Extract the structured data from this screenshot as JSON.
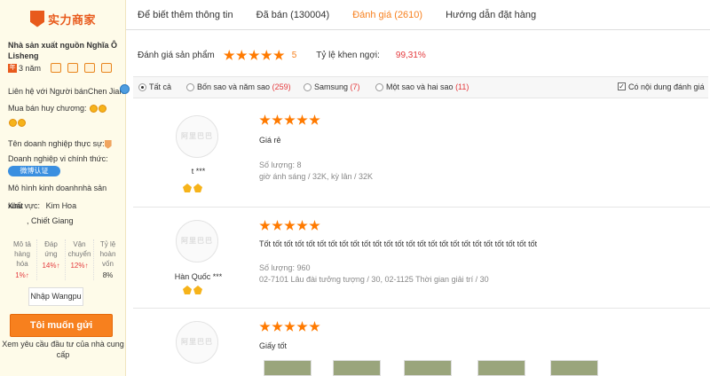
{
  "seller": {
    "logo_text": "实力商家",
    "name": "Nhà sản xuất nguồn Nghĩa Ô Lisheng",
    "years": "3 năm",
    "contact_label": "Liên hệ với Người bán",
    "contact_name": "Chen Jian",
    "medals_label": "Mua bán huy chương:",
    "real_business_label": "Tên doanh nghiệp thực sự:",
    "official_label": "Doanh nghiệp vi chính thức:",
    "weibo_badge": "微博认证",
    "model_label": "Mô hình kinh doanh",
    "model_value": "nhà sản",
    "model_overflow": "xuất",
    "region_label": "Khu vực:",
    "region_city": "Kim Hoa",
    "region_province": ", Chiết Giang",
    "stats": [
      {
        "label": "Mô tả hàng hóa",
        "value": "1%↑",
        "color": "red"
      },
      {
        "label": "Đáp ứng",
        "value": "14%↑",
        "color": "red"
      },
      {
        "label": "Vận chuyển",
        "value": "12%↑",
        "color": "red"
      },
      {
        "label": "Tỷ lệ hoàn vốn",
        "value": "8%",
        "color": "black"
      }
    ],
    "wangpu_button": "Nhập Wangpu",
    "cta_button": "Tôi muốn gửi",
    "cta_note": "Xem yêu cầu đầu tư của nhà cung cấp"
  },
  "tabs": [
    {
      "label": "Để biết thêm thông tin",
      "active": false
    },
    {
      "label": "Đã bán (130004)",
      "active": false
    },
    {
      "label": "Đánh giá (2610)",
      "active": true
    },
    {
      "label": "Hướng dẫn đặt hàng",
      "active": false
    }
  ],
  "summary": {
    "rating_label": "Đánh giá sản phẩm",
    "rating_value": "5",
    "rating_stars": 5,
    "praise_label": "Tỷ lệ khen ngợi:",
    "praise_value": "99,31%"
  },
  "filters": {
    "all": "Tất cả",
    "four_five": "Bốn sao và năm sao",
    "four_five_count": "(259)",
    "samsung": "Samsung",
    "samsung_count": "(7)",
    "one_two": "Một sao và hai sao",
    "one_two_count": "(11)",
    "has_content": "Có nội dung đánh giá",
    "has_content_checked": true
  },
  "reviews": [
    {
      "user": "t ***",
      "avatar_text": "阿里巴巴",
      "stars": 5,
      "text": "Giá rẻ",
      "quantity": "Số lượng: 8",
      "variant": "giờ ánh sáng / 32K, kỳ lân / 32K"
    },
    {
      "user": "Hàn Quốc ***",
      "avatar_text": "阿里巴巴",
      "stars": 5,
      "text": "Tốt tốt tốt tốt tốt tốt tốt tốt tốt tốt tốt tốt tốt tốt tốt tốt tốt tốt tốt tốt tốt tốt tốt tốt tốt",
      "quantity": "Số lượng: 960",
      "variant": "02-7101 Lâu đài tưởng tượng / 30, 02-1125 Thời gian giải trí / 30"
    },
    {
      "user": "",
      "avatar_text": "阿里巴巴",
      "stars": 5,
      "text": "Giấy tốt",
      "quantity": "",
      "variant": ""
    }
  ]
}
